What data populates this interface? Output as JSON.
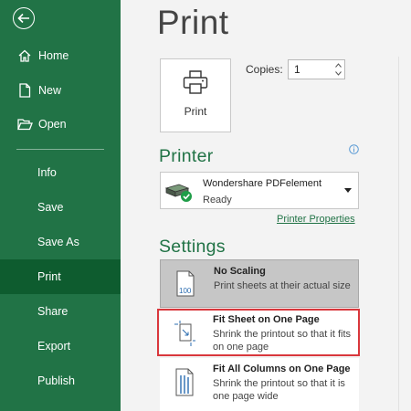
{
  "sidebar": {
    "items": [
      {
        "label": "Home",
        "icon": "home-icon"
      },
      {
        "label": "New",
        "icon": "new-document-icon"
      },
      {
        "label": "Open",
        "icon": "folder-open-icon"
      },
      {
        "label": "Info"
      },
      {
        "label": "Save"
      },
      {
        "label": "Save As"
      },
      {
        "label": "Print",
        "active": true
      },
      {
        "label": "Share"
      },
      {
        "label": "Export"
      },
      {
        "label": "Publish"
      }
    ]
  },
  "main": {
    "title": "Print",
    "print_button_label": "Print",
    "copies_label": "Copies:",
    "copies_value": "1",
    "printer_heading": "Printer",
    "printer": {
      "name": "Wondershare PDFelement",
      "status": "Ready"
    },
    "printer_properties_label": "Printer Properties",
    "settings_heading": "Settings",
    "scaling_options": [
      {
        "title": "No Scaling",
        "description": "Print sheets at their actual size",
        "selected": true
      },
      {
        "title": "Fit Sheet on One Page",
        "description": "Shrink the printout so that it fits on one page"
      },
      {
        "title": "Fit All Columns on One Page",
        "description": "Shrink the printout so that it is one page wide"
      }
    ]
  },
  "colors": {
    "accent": "#217346",
    "active_nav": "#0e5c2f",
    "highlight": "#d9373c"
  }
}
